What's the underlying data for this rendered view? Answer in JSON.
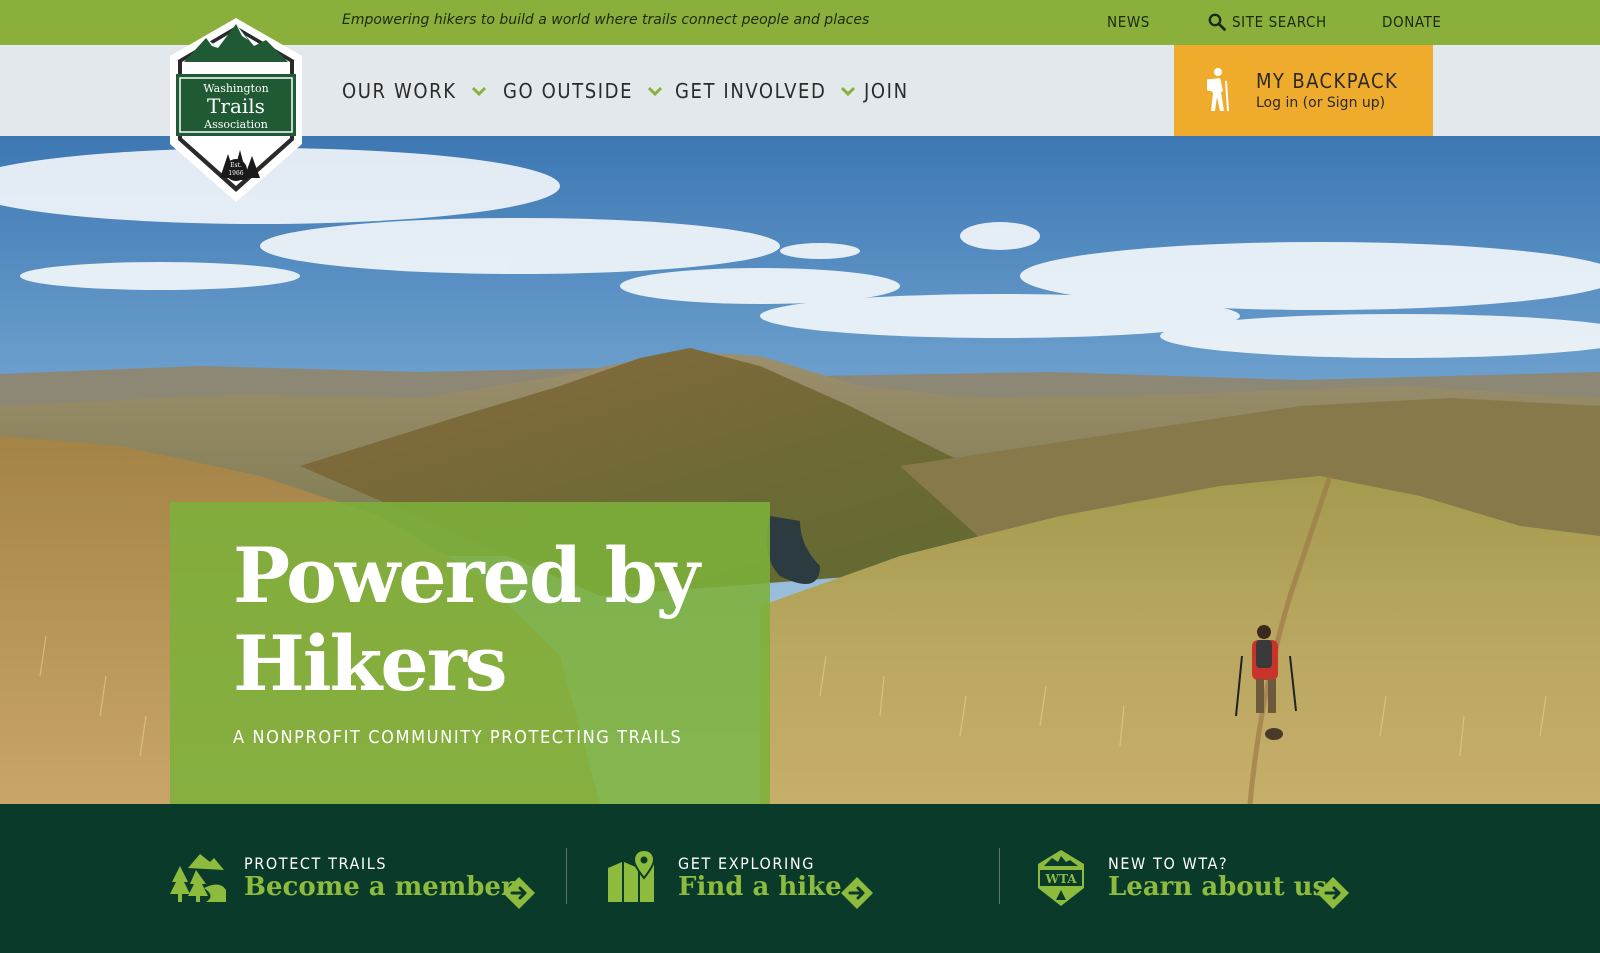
{
  "topbar": {
    "tagline": "Empowering hikers to build a world where trails connect people and places",
    "news": "News",
    "search": "Site Search",
    "donate": "Donate"
  },
  "logo": {
    "line1": "Washington",
    "line2": "Trails",
    "line3": "Association",
    "est": "Est.",
    "year": "1966"
  },
  "nav": {
    "items": [
      {
        "label": "Our Work",
        "has_dropdown": true
      },
      {
        "label": "Go Outside",
        "has_dropdown": true
      },
      {
        "label": "Get Involved",
        "has_dropdown": true
      },
      {
        "label": "Join",
        "has_dropdown": false
      }
    ]
  },
  "backpack": {
    "title": "My Backpack",
    "subtitle": "Log in (or Sign up)"
  },
  "hero": {
    "title": "Powered by Hikers",
    "subtitle": "A nonprofit community protecting trails"
  },
  "cta": [
    {
      "kicker": "Protect Trails",
      "link": "Become a member",
      "icon": "trees-mountain-icon"
    },
    {
      "kicker": "Get Exploring",
      "link": "Find a hike",
      "icon": "map-pin-icon"
    },
    {
      "kicker": "New to WTA?",
      "link": "Learn about us",
      "icon": "wta-badge-icon"
    }
  ],
  "colors": {
    "topbar_green": "#8aaf3b",
    "nav_bg": "#e3e8ec",
    "backpack_orange": "#efab2c",
    "hero_panel_green": "#7cb03a",
    "cta_bg": "#0a3a2a",
    "cta_link_green": "#8dbb3e"
  }
}
